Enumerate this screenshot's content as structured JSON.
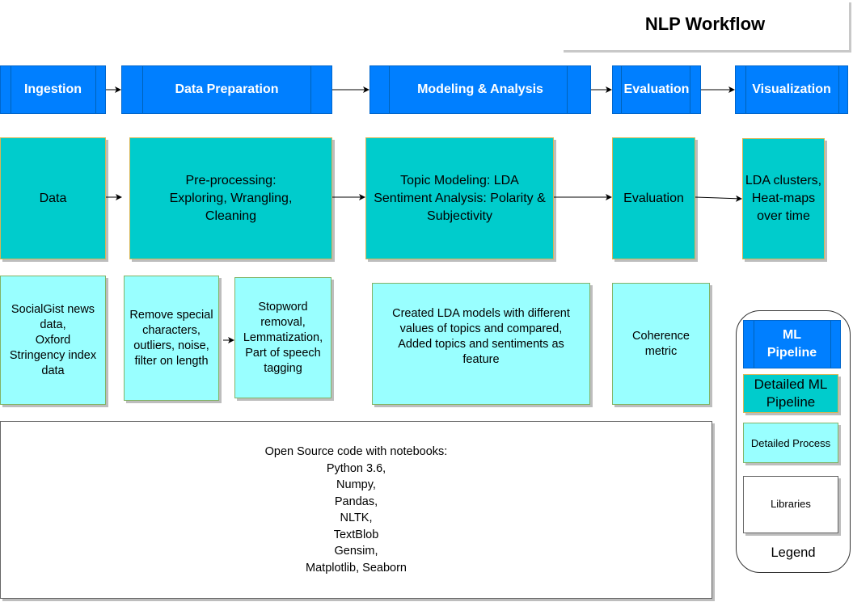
{
  "title": "NLP Workflow",
  "pipeline_stages": [
    {
      "label": "Ingestion"
    },
    {
      "label": "Data Preparation"
    },
    {
      "label": "Modeling & Analysis"
    },
    {
      "label": "Evaluation"
    },
    {
      "label": "Visualization"
    }
  ],
  "detailed_pipeline": [
    {
      "label": "Data"
    },
    {
      "label": "Pre-processing:\nExploring, Wrangling,\nCleaning"
    },
    {
      "label": "Topic Modeling: LDA\nSentiment Analysis: Polarity &\nSubjectivity"
    },
    {
      "label": "Evaluation"
    },
    {
      "label": "LDA clusters,\nHeat-maps\nover time"
    }
  ],
  "detailed_process": [
    {
      "label": "SocialGist news\ndata,\nOxford\nStringency index\ndata"
    },
    {
      "label": "Remove special\ncharacters,\noutliers, noise,\nfilter on length"
    },
    {
      "label": "Stopword\nremoval,\nLemmatization,\nPart of speech\ntagging"
    },
    {
      "label": "Created LDA models with different\nvalues of topics and compared,\nAdded topics and sentiments as\nfeature"
    },
    {
      "label": "Coherence\nmetric"
    }
  ],
  "libraries": {
    "heading": "Open Source code with notebooks:",
    "items": [
      "Python 3.6,",
      "Numpy,",
      "Pandas,",
      "NLTK,",
      "TextBlob",
      "Gensim,",
      "Matplotlib, Seaborn"
    ]
  },
  "legend": {
    "title": "Legend",
    "items": [
      {
        "label": "ML\nPipeline",
        "style": "stage"
      },
      {
        "label": "Detailed ML\nPipeline",
        "style": "teal"
      },
      {
        "label": "Detailed Process",
        "style": "cyan"
      },
      {
        "label": "Libraries",
        "style": "white"
      }
    ]
  },
  "colors": {
    "stage_fill": "#007fff",
    "teal_fill": "#00cccc",
    "cyan_fill": "#99ffff",
    "white_fill": "#ffffff"
  }
}
